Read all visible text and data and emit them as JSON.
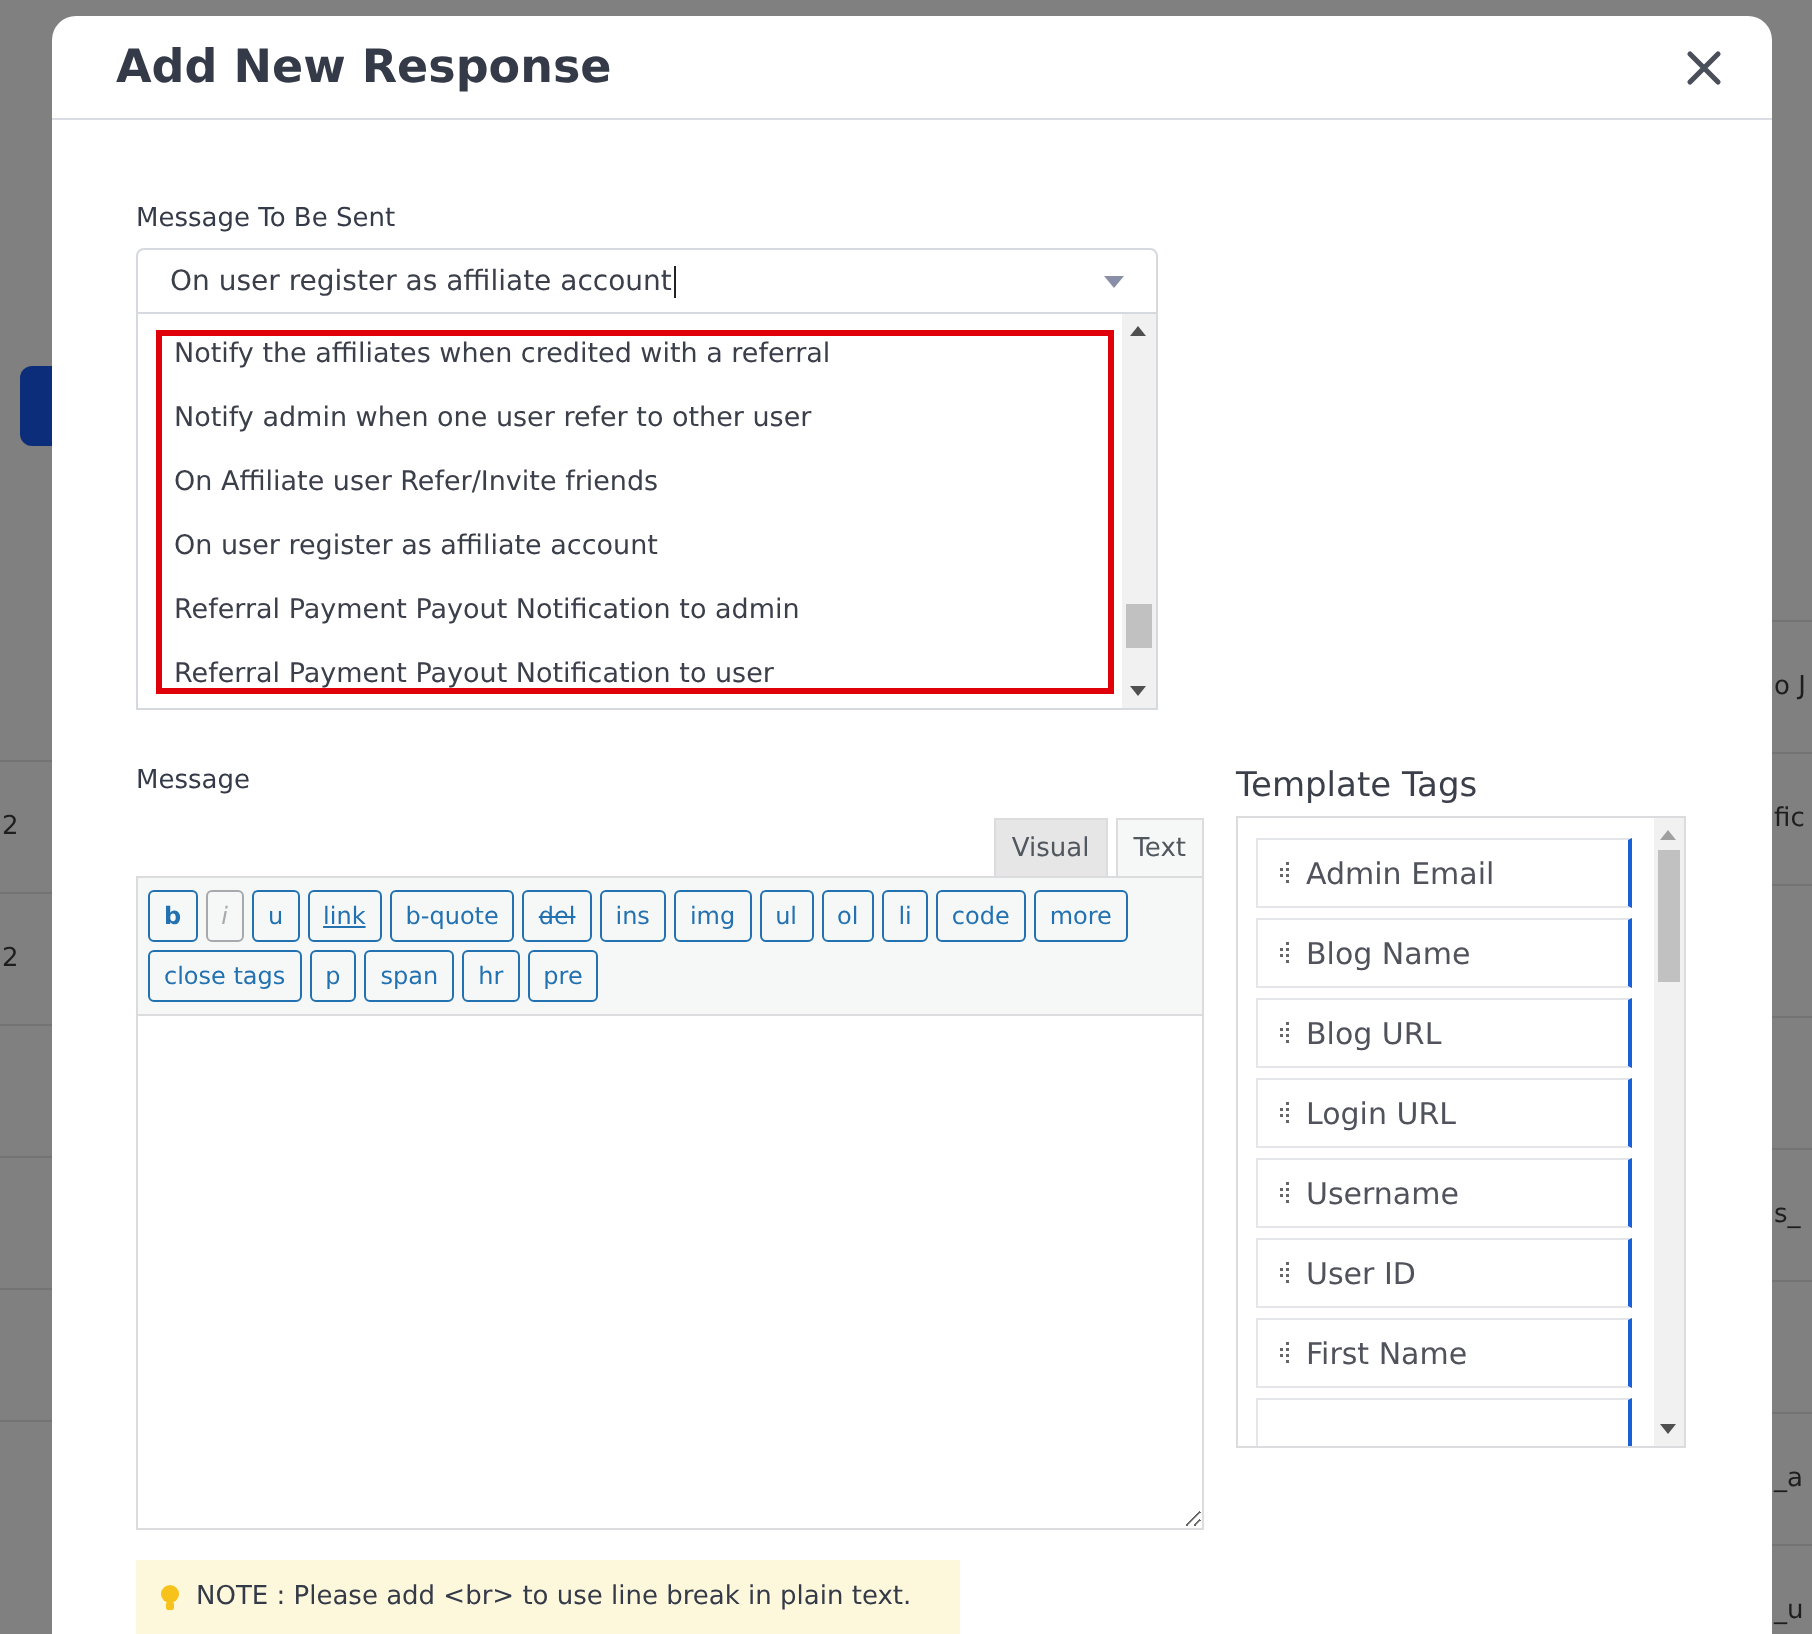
{
  "backdrop": {
    "left_rows": [
      {
        "text": "2"
      },
      {
        "text": "2"
      },
      {},
      {},
      {},
      {}
    ],
    "right_rows": [
      {
        "text": "o J"
      },
      {
        "text": "fic"
      },
      {},
      {},
      {
        "text": "s_"
      },
      {},
      {
        "text": "_a"
      },
      {
        "text": "_u"
      }
    ]
  },
  "dialog": {
    "title": "Add New Response"
  },
  "message_select": {
    "label": "Message To Be Sent",
    "value": "On user register as affiliate account",
    "options": [
      {
        "label": "Notify the affiliates when credited with a referral"
      },
      {
        "label": "Notify admin when one user refer to other user"
      },
      {
        "label": "On Affiliate user Refer/Invite friends"
      },
      {
        "label": "On user register as affiliate account"
      },
      {
        "label": "Referral Payment Payout Notification to admin"
      },
      {
        "label": "Referral Payment Payout Notification to user"
      }
    ]
  },
  "message": {
    "label": "Message",
    "tabs": [
      {
        "label": "Visual",
        "selected": false
      },
      {
        "label": "Text",
        "selected": true
      }
    ],
    "toolbar": [
      {
        "label": "b",
        "kind": "bold"
      },
      {
        "label": "i",
        "kind": "italic"
      },
      {
        "label": "u",
        "kind": "plain"
      },
      {
        "label": "link",
        "kind": "link"
      },
      {
        "label": "b-quote",
        "kind": "plain"
      },
      {
        "label": "del",
        "kind": "strike"
      },
      {
        "label": "ins",
        "kind": "plain"
      },
      {
        "label": "img",
        "kind": "plain"
      },
      {
        "label": "ul",
        "kind": "plain"
      },
      {
        "label": "ol",
        "kind": "plain"
      },
      {
        "label": "li",
        "kind": "plain"
      },
      {
        "label": "code",
        "kind": "plain"
      },
      {
        "label": "more",
        "kind": "plain"
      },
      {
        "label": "close tags",
        "kind": "plain"
      },
      {
        "label": "p",
        "kind": "plain"
      },
      {
        "label": "span",
        "kind": "plain"
      },
      {
        "label": "hr",
        "kind": "plain"
      },
      {
        "label": "pre",
        "kind": "plain"
      }
    ]
  },
  "template_tags": {
    "title": "Template Tags",
    "items": [
      "Admin Email",
      "Blog Name",
      "Blog URL",
      "Login URL",
      "Username",
      "User ID",
      "First Name"
    ]
  },
  "note": "NOTE : Please add <br> to use line break in plain text."
}
